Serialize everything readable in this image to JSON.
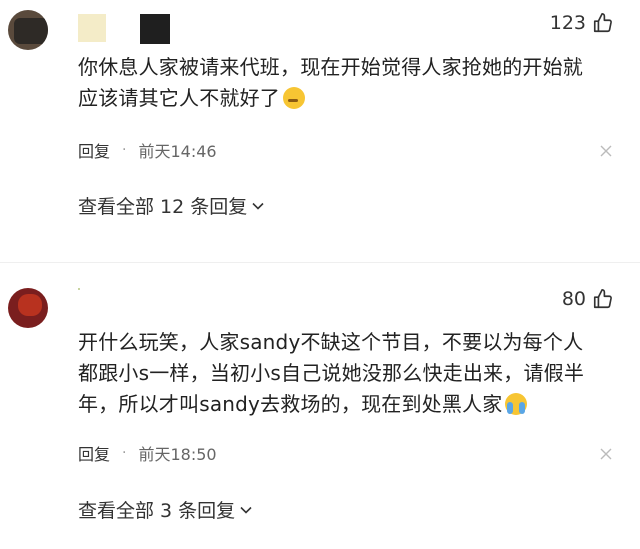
{
  "comments": [
    {
      "likes": "123",
      "text_lines": [
        "你休息人家被请来代班，现在开始觉得人家抢她的开始就",
        "应该请其它人不就好了"
      ],
      "emoji": "smirking-face-icon",
      "reply_label": "回复",
      "separator": "·",
      "timestamp": "前天14:46",
      "view_replies": "查看全部 12 条回复"
    },
    {
      "likes": "80",
      "text_lines": [
        "开什么玩笑，人家sandy不缺这个节目，不要以为每个人",
        "都跟小s一样，当初小s自己说她没那么快走出来，请假半",
        "年，所以才叫sandy去救场的，现在到处黑人家"
      ],
      "emoji": "crying-face-icon",
      "reply_label": "回复",
      "separator": "·",
      "timestamp": "前天18:50",
      "view_replies": "查看全部 3 条回复"
    }
  ],
  "colors": {
    "text": "#222222",
    "meta": "#666666",
    "icon": "#333333"
  }
}
